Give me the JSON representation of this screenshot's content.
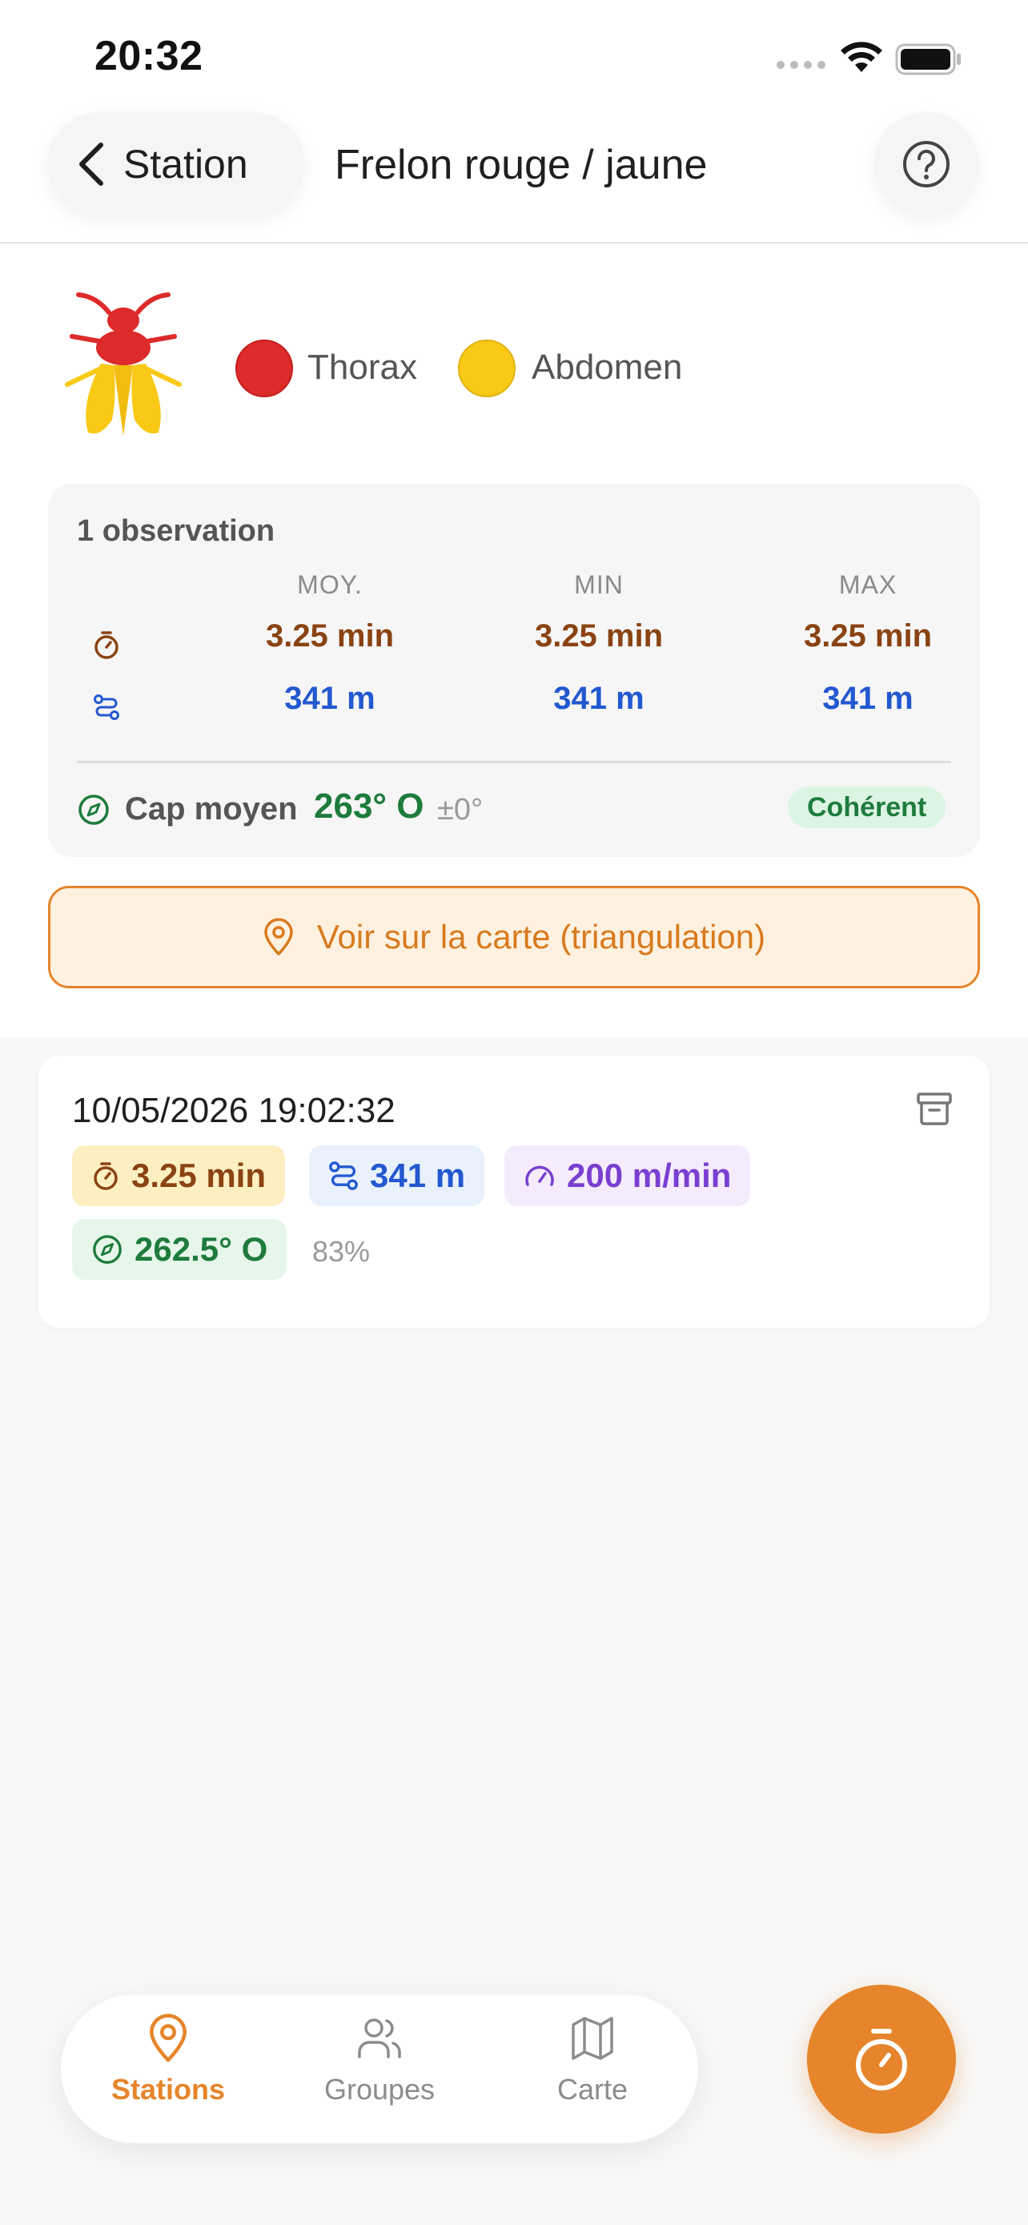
{
  "status_bar": {
    "time": "20:32"
  },
  "header": {
    "back_label": "Station",
    "title": "Frelon rouge / jaune"
  },
  "species": {
    "thorax_label": "Thorax",
    "thorax_color": "#dd2a2a",
    "abdomen_label": "Abdomen",
    "abdomen_color": "#f9c916"
  },
  "stats": {
    "observation_count": "1 observation",
    "columns": [
      "MOY.",
      "MIN",
      "MAX"
    ],
    "time_values": [
      "3.25 min",
      "3.25 min",
      "3.25 min"
    ],
    "distance_values": [
      "341 m",
      "341 m",
      "341 m"
    ],
    "heading_label": "Cap moyen",
    "heading_value": "263° O",
    "heading_spread": "±0°",
    "consistency_badge": "Cohérent"
  },
  "map_button": {
    "label": "Voir sur la carte (triangulation)"
  },
  "observation": {
    "datetime": "10/05/2026 19:02:32",
    "time": "3.25 min",
    "distance": "341 m",
    "speed": "200 m/min",
    "heading": "262.5° O",
    "confidence": "83%"
  },
  "bottom_nav": {
    "items": [
      {
        "label": "Stations",
        "active": true
      },
      {
        "label": "Groupes",
        "active": false
      },
      {
        "label": "Carte",
        "active": false
      }
    ]
  },
  "colors": {
    "accent": "#e6852b",
    "time": "#8a4312",
    "distance": "#2358d0",
    "speed": "#7a3fd1",
    "heading": "#1e7b3c"
  }
}
